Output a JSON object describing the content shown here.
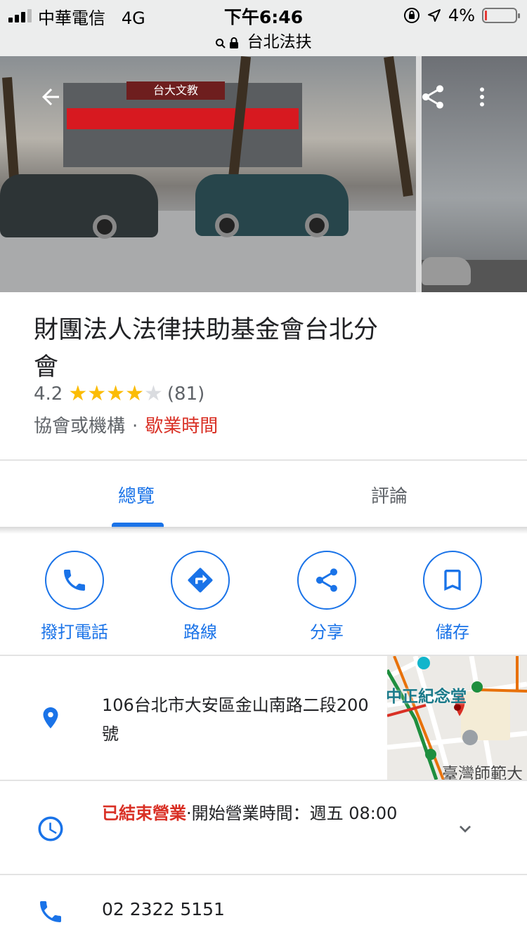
{
  "status_bar": {
    "carrier": "中華電信",
    "network": "4G",
    "time": "下午6:46",
    "url": "台北法扶",
    "battery": "4%",
    "battery_level": 0.04
  },
  "place": {
    "name": "財團法人法律扶助基金會台北分會",
    "rating": "4.2",
    "stars_filled": 4,
    "review_count": "(81)",
    "category": "協會或機構",
    "separator": "·",
    "hours_link": "歇業時間"
  },
  "photo_sign": "台大文教",
  "tabs": [
    {
      "label": "總覽",
      "active": true
    },
    {
      "label": "評論",
      "active": false
    }
  ],
  "actions": [
    {
      "label": "撥打電話",
      "icon": "phone-icon"
    },
    {
      "label": "路線",
      "icon": "directions-icon"
    },
    {
      "label": "分享",
      "icon": "share-icon"
    },
    {
      "label": "儲存",
      "icon": "bookmark-icon"
    }
  ],
  "address": {
    "text": "106台北市大安區金山南路二段200號",
    "icon": "location-pin-icon"
  },
  "map_thumb": {
    "label_top": "中正紀念堂",
    "label_bottom": "臺灣師範大"
  },
  "hours": {
    "status": "已結束營業",
    "separator": "·",
    "next_open": "開始營業時間：週五 08:00",
    "icon": "clock-icon"
  },
  "phone": {
    "number": "02 2322 5151",
    "icon": "phone-icon"
  },
  "colors": {
    "accent": "#1a73e8",
    "closed": "#d93025",
    "star": "#fbbc04",
    "star_empty": "#dadce0"
  }
}
